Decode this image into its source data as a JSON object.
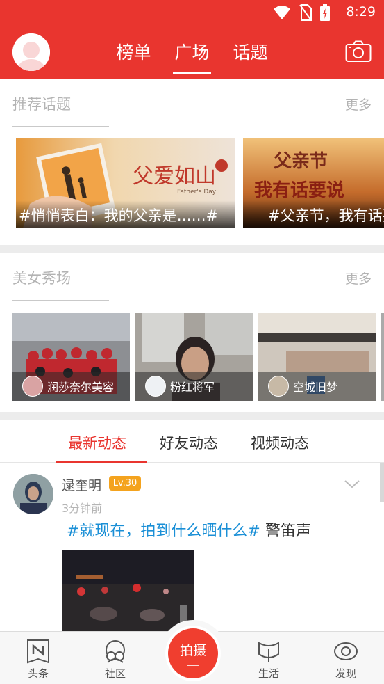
{
  "status_bar": {
    "time": "8:29",
    "icons": [
      "wifi-icon",
      "no-sim-icon",
      "battery-charging-icon"
    ]
  },
  "header": {
    "tabs": [
      {
        "label": "榜单",
        "active": false
      },
      {
        "label": "广场",
        "active": true
      },
      {
        "label": "话题",
        "active": false
      }
    ],
    "icons": {
      "avatar": "avatar-icon",
      "camera": "camera-icon"
    },
    "accent_color": "#e9352f"
  },
  "topics": {
    "title": "推荐话题",
    "more": "更多",
    "cards": [
      {
        "caption": "#悄悄表白：我的父亲是……#",
        "image_text": "父爱如山",
        "image_sub": "Father's Day"
      },
      {
        "caption": "#父亲节，我有话要说",
        "image_text_1": "父亲节",
        "image_text_2": "我有话要说"
      }
    ]
  },
  "beauty": {
    "title": "美女秀场",
    "more": "更多",
    "cards": [
      {
        "name": "润莎奈尔美容"
      },
      {
        "name": "粉红将军"
      },
      {
        "name": "空城旧梦"
      }
    ]
  },
  "feed": {
    "tabs": [
      {
        "label": "最新动态",
        "active": true
      },
      {
        "label": "好友动态",
        "active": false
      },
      {
        "label": "视频动态",
        "active": false
      }
    ],
    "posts": [
      {
        "user": "逯奎明",
        "level": "Lv.30",
        "time": "3分钟前",
        "tag": "#就现在，拍到什么晒什么#",
        "text": " 警笛声"
      }
    ]
  },
  "bottom_nav": {
    "items": [
      {
        "label": "头条",
        "icon": "news-icon"
      },
      {
        "label": "社区",
        "icon": "community-icon"
      },
      {
        "label": "生活",
        "icon": "life-icon"
      },
      {
        "label": "发现",
        "icon": "eye-icon"
      }
    ],
    "shoot_label": "拍摄"
  }
}
